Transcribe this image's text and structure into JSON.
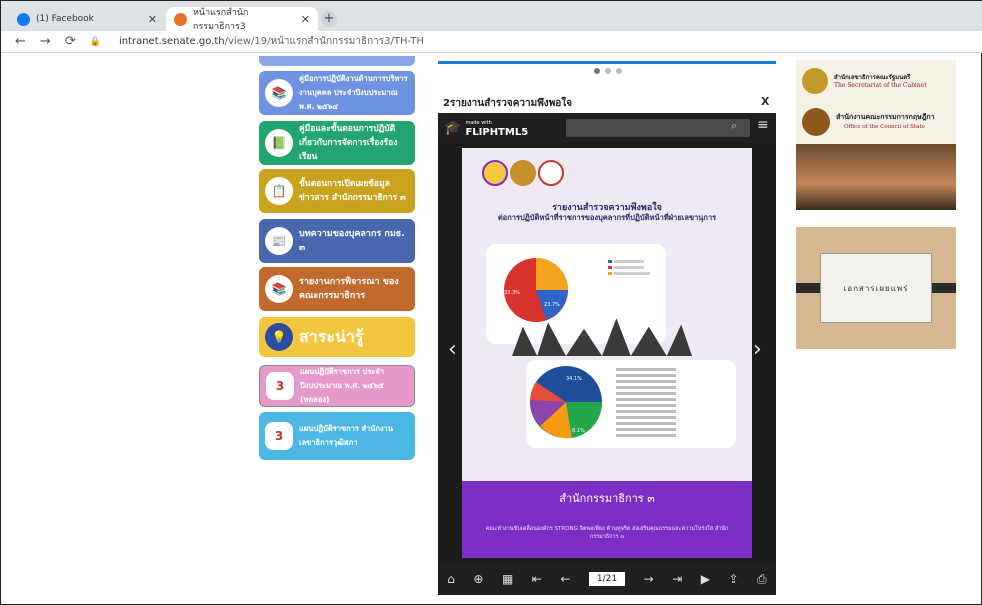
{
  "browser": {
    "tabs": [
      {
        "label": "(1) Facebook",
        "icon": "facebook-icon"
      },
      {
        "label": "หน้าแรกสำนักกรรมาธิการ3",
        "icon": "senate-icon"
      }
    ],
    "url_domain": "intranet.senate.go.th",
    "url_path": "/view/19/หน้าแรกสำนักกรรมาธิการ3/TH-TH"
  },
  "sidebar_buttons": [
    {
      "label": "คู่มือการปฏิบัติงานด้านการบริหารงานบุคคล ประจำปีงบประมาณ พ.ศ. ๒๕๖๔",
      "color": "#6f93e0"
    },
    {
      "label": "คู่มือและขั้นตอนการปฏิบัติ เกี่ยวกับการจัดการเรื่องร้องเรียน",
      "color": "#23a56f"
    },
    {
      "label": "ขั้นตอนการเปิดเผยข้อมูลข่าวสาร สำนักกรรมาธิการ ๓",
      "color": "#c9a21e"
    },
    {
      "label": "บทความของบุคลากร กมธ. ๓",
      "color": "#4967ad"
    },
    {
      "label": "รายงานการพิจารณา ของคณะกรรมาธิการ",
      "color": "#c26a2e"
    },
    {
      "label": "สาระน่ารู้",
      "color": "#f3c640"
    },
    {
      "label": "แผนปฏิบัติราชการ ประจำปีงบประมาณ พ.ศ. ๒๕๖๕ (ทดลอง)",
      "color": "#e69ac9"
    },
    {
      "label": "แผนปฏิบัติราชการ สำนักงานเลขาธิการวุฒิสภา",
      "color": "#4cb6e4"
    }
  ],
  "carousel_dots": 3,
  "modal": {
    "title": "2รายงานสำรวจความพึงพอใจ",
    "close": "X"
  },
  "flipbook": {
    "made_with": "made with",
    "brand": "FLIPHTML5",
    "page_title_1": "รายงานสำรวจความพึงพอใจ",
    "page_title_2": "ต่อการปฏิบัติหน้าที่ราชการของบุคลากรที่ปฏิบัติหน้าที่ฝ่ายเลขานุการ",
    "footer_title": "สำนักกรรมาธิการ ๓",
    "footer_sub": "คณะทำงานขับเคลื่อนองค์กร STRONG จิตพอเพียง ต้านทุจริต ส่งเสริมคุณธรรมและความโปร่งใส สำนักกรรมาธิการ ๓",
    "page_indicator": "1/21",
    "pie1_labels": [
      "33.3%",
      "23.7%"
    ],
    "pie2_labels": [
      "34.1%",
      "8.1%"
    ]
  },
  "right": {
    "cabinet_th": "สำนักเลขาธิการคณะรัฐมนตรี",
    "cabinet_en": "The Secretariat of the Cabinet",
    "council_th": "สำนักงานคณะกรรมการกฤษฎีกา",
    "council_en": "Office of the Council of State",
    "doc_label": "เอกสารเผยแพร่"
  }
}
